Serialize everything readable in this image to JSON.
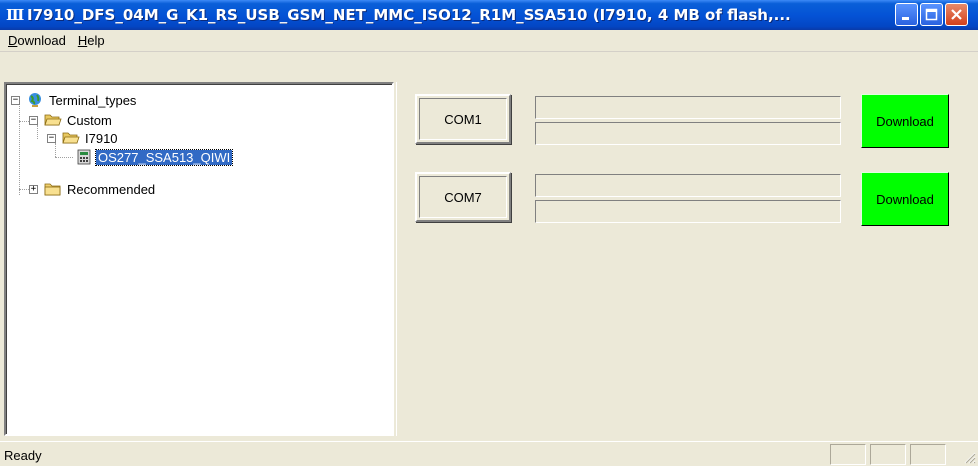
{
  "window": {
    "title": "I7910_DFS_04M_G_K1_RS_USB_GSM_NET_MMC_ISO12_R1M_SSA510 (I7910, 4 MB of flash,...",
    "icon": "app-icon",
    "icon_glyph": "Ⅲ"
  },
  "menu": {
    "items": [
      {
        "label": "Download",
        "mnemonic": "D"
      },
      {
        "label": "Help",
        "mnemonic": "H"
      }
    ]
  },
  "tree": {
    "nodes": [
      {
        "label": "Terminal_types",
        "icon": "globe-network-icon",
        "expanded": true,
        "level": 0
      },
      {
        "label": "Custom",
        "icon": "folder-open-icon",
        "expanded": true,
        "level": 1
      },
      {
        "label": "I7910",
        "icon": "folder-open-icon",
        "expanded": true,
        "level": 2
      },
      {
        "label": "OS277_SSA513_QIWI",
        "icon": "device-icon",
        "selected": true,
        "level": 3
      },
      {
        "label": "Recommended",
        "icon": "folder-closed-icon",
        "expanded": false,
        "level": 1
      }
    ]
  },
  "ports": [
    {
      "name": "COM1",
      "progress_top": 0,
      "progress_bottom": 0,
      "button_label": "Download",
      "button_color": "#00ff00"
    },
    {
      "name": "COM7",
      "progress_top": 0,
      "progress_bottom": 0,
      "button_label": "Download",
      "button_color": "#00ff00"
    }
  ],
  "status": {
    "text": "Ready"
  },
  "colors": {
    "titlebar": "#0453d6",
    "selection": "#316ac5",
    "download_button": "#00ff00",
    "face": "#ece9d8"
  }
}
